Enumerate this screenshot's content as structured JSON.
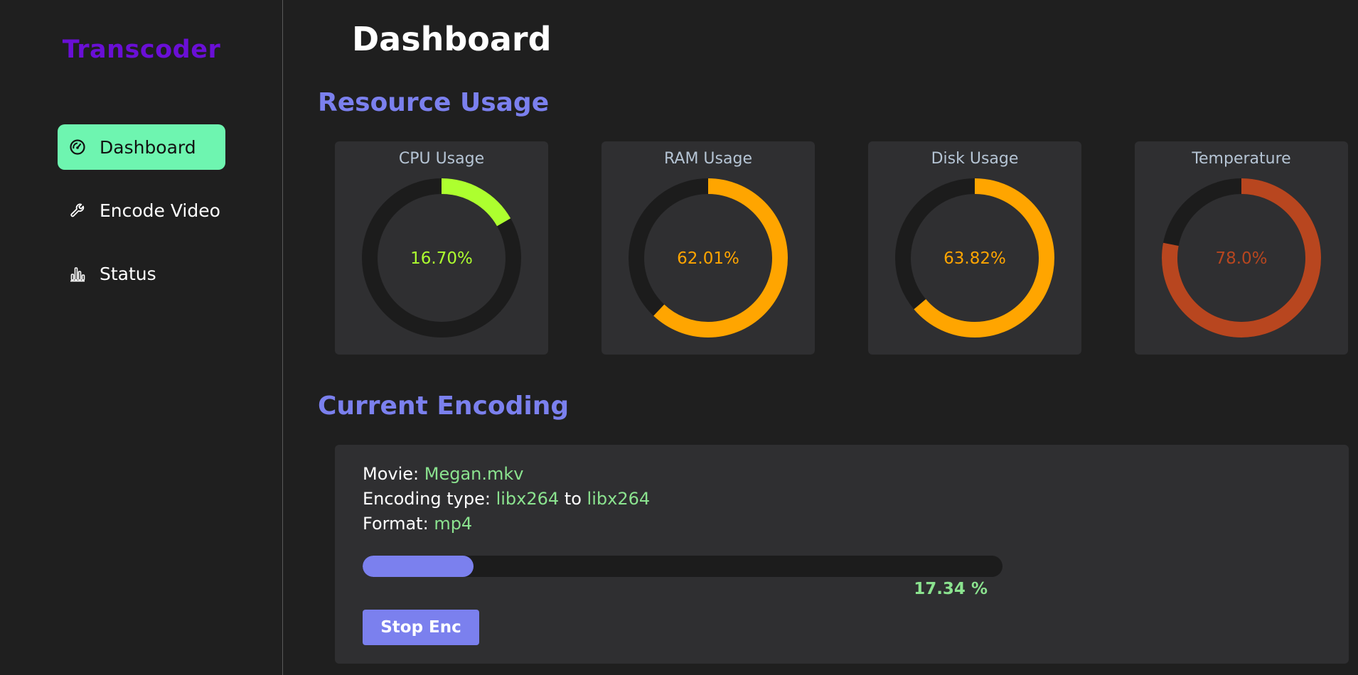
{
  "app": {
    "brand": "Transcoder",
    "brand_color": "#6a0fd6",
    "accent": "#7b80ee",
    "active_nav_color": "#6ef5b0"
  },
  "sidebar": {
    "items": [
      {
        "label": "Dashboard",
        "icon": "speedometer-icon",
        "active": true
      },
      {
        "label": "Encode Video",
        "icon": "wrench-icon",
        "active": false
      },
      {
        "label": "Status",
        "icon": "bar-chart-icon",
        "active": false
      }
    ]
  },
  "main": {
    "title": "Dashboard",
    "resource_section_title": "Resource Usage",
    "gauges": [
      {
        "title": "CPU Usage",
        "value_text": "16.70%",
        "fraction": 0.167,
        "color": "#adff2f"
      },
      {
        "title": "RAM Usage",
        "value_text": "62.01%",
        "fraction": 0.6201,
        "color": "#ffa500"
      },
      {
        "title": "Disk Usage",
        "value_text": "63.82%",
        "fraction": 0.6382,
        "color": "#ffa500"
      },
      {
        "title": "Temperature",
        "value_text": "78.0%",
        "fraction": 0.78,
        "color": "#b8461f"
      }
    ],
    "encoding_section_title": "Current Encoding",
    "encoding": {
      "movie_label": "Movie:",
      "movie": "Megan.mkv",
      "type_label": "Encoding type:",
      "from_codec": "libx264",
      "to_word": "to",
      "to_codec": "libx264",
      "format_label": "Format:",
      "format": "mp4",
      "progress_fraction": 0.1734,
      "progress_text": "17.34 %",
      "stop_button": "Stop Enc"
    }
  }
}
